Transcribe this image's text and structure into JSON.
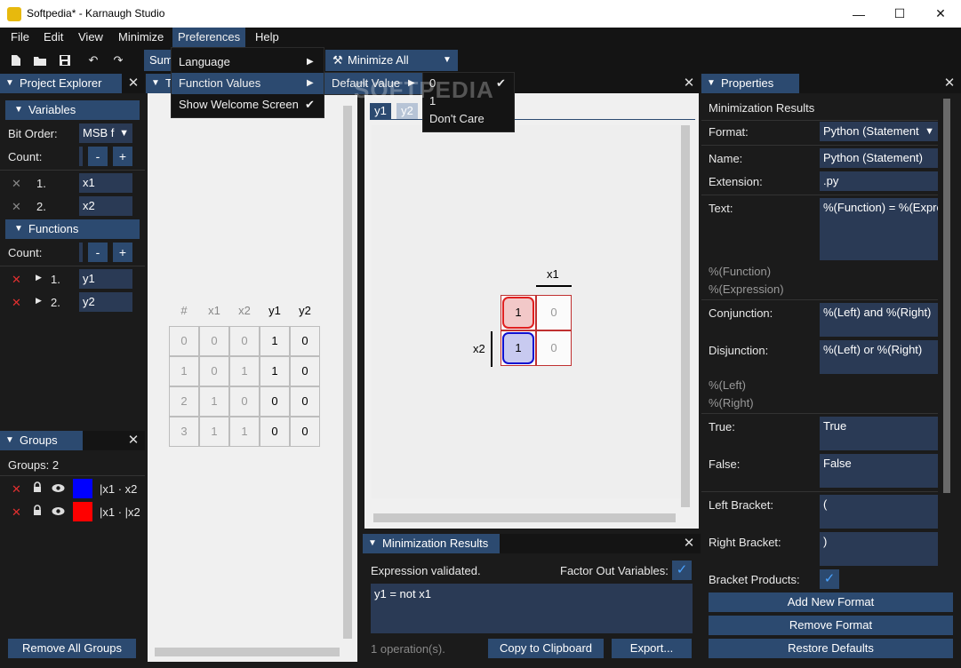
{
  "window": {
    "title": "Softpedia* - Karnaugh Studio",
    "minimize": "—",
    "maximize": "☐",
    "close": "✕"
  },
  "menubar": [
    "File",
    "Edit",
    "View",
    "Minimize",
    "Preferences",
    "Help"
  ],
  "toolbar": {
    "sum_label": "Sum",
    "minimize_all_label": "Minimize All"
  },
  "preferences_menu": {
    "items": [
      "Language",
      "Function Values",
      "Show Welcome Screen"
    ],
    "function_values_sub": "Default Value",
    "default_value_options": [
      "0",
      "1",
      "Don't Care"
    ]
  },
  "watermark": "SOFTPEDIA",
  "project_explorer": {
    "title": "Project Explorer",
    "variables_header": "Variables",
    "bit_order_label": "Bit Order:",
    "bit_order_value": "MSB f",
    "count_label": "Count:",
    "variables": [
      {
        "index": "1.",
        "name": "x1"
      },
      {
        "index": "2.",
        "name": "x2"
      }
    ],
    "functions_header": "Functions",
    "functions": [
      {
        "index": "1.",
        "name": "y1"
      },
      {
        "index": "2.",
        "name": "y2"
      }
    ],
    "minus": "-",
    "plus": "+"
  },
  "groups": {
    "title": "Groups",
    "count_text": "Groups: 2",
    "items": [
      {
        "color": "#0000ff",
        "expr": "|x1 · x2"
      },
      {
        "color": "#ff0000",
        "expr": "|x1 · |x2"
      }
    ],
    "remove_all": "Remove All Groups"
  },
  "truth_table": {
    "tab_label": "T",
    "headers": [
      "#",
      "x1",
      "x2",
      "y1",
      "y2"
    ],
    "rows": [
      [
        "0",
        "0",
        "0",
        "1",
        "0"
      ],
      [
        "1",
        "0",
        "1",
        "1",
        "0"
      ],
      [
        "2",
        "1",
        "0",
        "0",
        "0"
      ],
      [
        "3",
        "1",
        "1",
        "0",
        "0"
      ]
    ]
  },
  "kmap": {
    "tabs": [
      "y1",
      "y2"
    ],
    "col_var": "x1",
    "row_var": "x2",
    "cells": [
      [
        "1",
        "0"
      ],
      [
        "1",
        "0"
      ]
    ]
  },
  "minimization_results": {
    "title": "Minimization Results",
    "status": "Expression validated.",
    "factor_label": "Factor Out Variables:",
    "check": "✓",
    "expression": "y1 = not x1",
    "operations": "1 operation(s).",
    "copy": "Copy to Clipboard",
    "export": "Export..."
  },
  "properties": {
    "title": "Properties",
    "section": "Minimization Results",
    "format_label": "Format:",
    "format_value": "Python (Statement",
    "name_label": "Name:",
    "name_value": "Python (Statement)",
    "extension_label": "Extension:",
    "extension_value": ".py",
    "text_label": "Text:",
    "text_value": "%(Function) = %(Expres",
    "text_hint1": "%(Function)",
    "text_hint2": "%(Expression)",
    "conj_label": "Conjunction:",
    "conj_value": "%(Left) and %(Right)",
    "disj_label": "Disjunction:",
    "disj_value": "%(Left) or %(Right)",
    "cd_hint1": "%(Left)",
    "cd_hint2": "%(Right)",
    "true_label": "True:",
    "true_value": "True",
    "false_label": "False:",
    "false_value": "False",
    "lb_label": "Left Bracket:",
    "lb_value": "(",
    "rb_label": "Right Bracket:",
    "rb_value": ")",
    "bp_label": "Bracket Products:",
    "add_format": "Add New Format",
    "remove_format": "Remove Format",
    "restore": "Restore Defaults"
  }
}
